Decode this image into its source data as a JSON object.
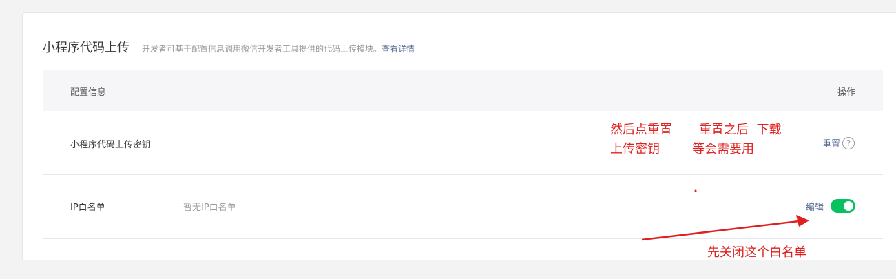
{
  "header": {
    "title": "小程序代码上传",
    "description": "开发者可基于配置信息调用微信开发者工具提供的代码上传模块。",
    "details_link": "查看详情"
  },
  "table": {
    "col_config": "配置信息",
    "col_action": "操作"
  },
  "rows": {
    "upload_key": {
      "label": "小程序代码上传密钥",
      "action": "重置",
      "help": "?"
    },
    "ip_whitelist": {
      "label": "IP白名单",
      "value": "暂无IP白名单",
      "action": "编辑",
      "toggle_on": true
    }
  },
  "annotations": {
    "note1_line1": "然后点重置",
    "note1_line2": "上传密钥",
    "note2_line1": "重置之后  下载",
    "note2_line2": "等会需要用",
    "note3": "先关闭这个白名单"
  },
  "colors": {
    "accent_link": "#576b95",
    "toggle_on": "#07c160",
    "annotation": "#e02020"
  }
}
